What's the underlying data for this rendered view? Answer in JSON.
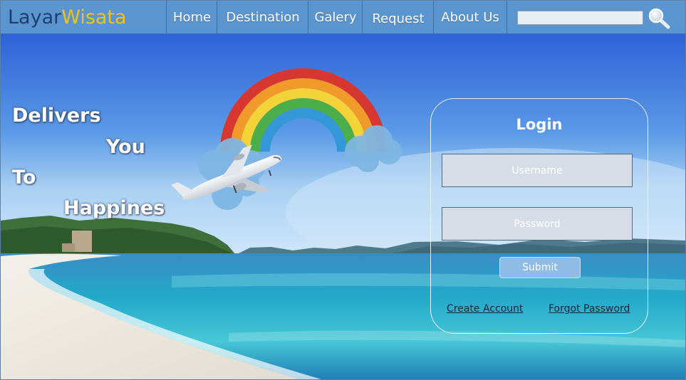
{
  "header": {
    "logo_part1": "Layar",
    "logo_part2": "Wisata",
    "nav": [
      "Home",
      "Destination",
      "Galery",
      "Request",
      "About Us"
    ],
    "search_placeholder": ""
  },
  "hero": {
    "tagline": [
      "Delivers",
      "You",
      "To",
      "Happines"
    ]
  },
  "login": {
    "title": "Login",
    "username_placeholder": "Username",
    "password_placeholder": "Password",
    "submit_label": "Submit",
    "create_account": "Create Account",
    "forgot_password": "Forgot Password"
  },
  "colors": {
    "header_bg": "#5b95d0",
    "logo_dark": "#1f3f6e",
    "logo_yellow": "#f2c21b",
    "submit_bg": "#8fbce6"
  }
}
